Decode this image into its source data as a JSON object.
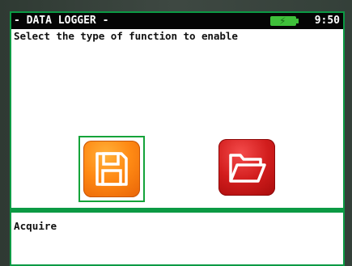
{
  "titlebar": {
    "title": "- DATA LOGGER -",
    "time": "9:50"
  },
  "icons": {
    "battery": "battery-charging-icon",
    "acquire": "floppy-disk-save-icon",
    "open": "folder-open-icon"
  },
  "main": {
    "prompt": "Select the type of function to enable",
    "functions": [
      {
        "name": "acquire",
        "selected": true
      },
      {
        "name": "open",
        "selected": false
      }
    ]
  },
  "status": {
    "text": "Acquire"
  },
  "colors": {
    "frame_green": "#0b9a44",
    "titlebar_bg": "#050505",
    "battery_green": "#3fbf3a",
    "selection_border": "#14a33a",
    "acquire_tile": "#ff8a14",
    "open_tile": "#d21d1d"
  }
}
